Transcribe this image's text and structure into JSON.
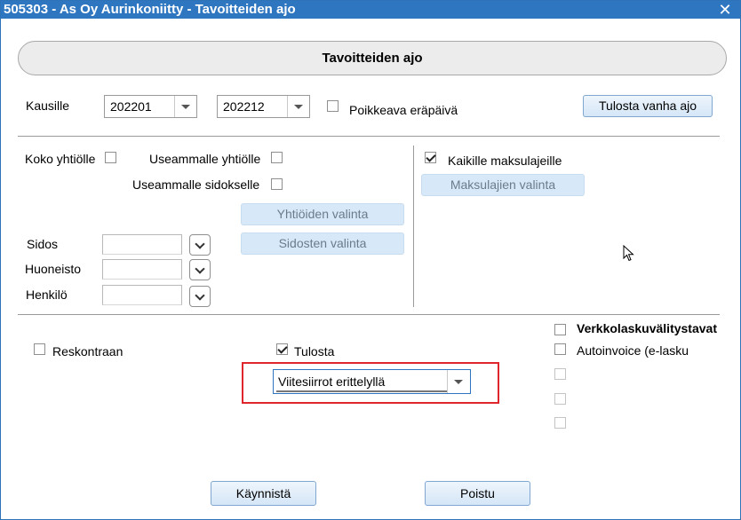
{
  "window": {
    "title": "505303 - As Oy Aurinkoniitty - Tavoitteiden ajo",
    "close_glyph": "✕"
  },
  "header": {
    "title": "Tavoitteiden ajo"
  },
  "period": {
    "label": "Kausille",
    "from": "202201",
    "to": "202212",
    "custom_due_date_label": "Poikkeava eräpäivä",
    "custom_due_date_checked": false,
    "print_old_run_button": "Tulosta vanha ajo"
  },
  "selection": {
    "all_companies_label": "Koko yhtiölle",
    "all_companies_checked": false,
    "multi_companies_label": "Useammalle yhtiölle",
    "multi_companies_checked": false,
    "multi_contracts_label": "Useammalle sidokselle",
    "multi_contracts_checked": false,
    "companies_button": "Yhtiöiden valinta",
    "contracts_button": "Sidosten valinta",
    "fields": [
      {
        "label": "Sidos",
        "value": ""
      },
      {
        "label": "Huoneisto",
        "value": ""
      },
      {
        "label": "Henkilö",
        "value": ""
      }
    ]
  },
  "payment_types": {
    "all_label": "Kaikille maksulajeille",
    "all_checked": true,
    "select_button": "Maksulajien valinta"
  },
  "options": {
    "ledger_label": "Reskontraan",
    "ledger_checked": false,
    "print_label": "Tulosta",
    "print_checked": true,
    "print_mode_selected": "Viitesiirrot erittelyllä"
  },
  "e_invoicing": {
    "title": "Verkkolaskuvälitystavat",
    "title_checked": false,
    "items": [
      {
        "label": "Autoinvoice (e-lasku",
        "checked": false,
        "enabled": true
      },
      {
        "label": "",
        "checked": false,
        "enabled": false
      },
      {
        "label": "",
        "checked": false,
        "enabled": false
      },
      {
        "label": "",
        "checked": false,
        "enabled": false
      }
    ]
  },
  "footer": {
    "start_button": "Käynnistä",
    "exit_button": "Poistu"
  },
  "colors": {
    "titlebar": "#2f76c1",
    "highlight_box": "#e0262d",
    "button_face": "#d5e6f7"
  }
}
